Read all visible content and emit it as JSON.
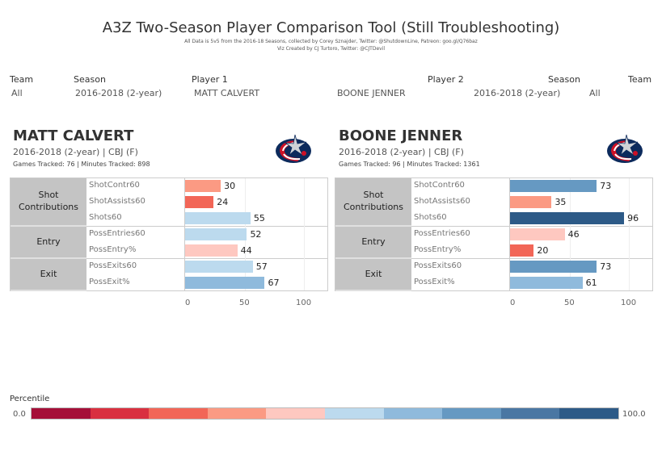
{
  "header": {
    "title": "A3Z Two-Season Player Comparison Tool (Still Troubleshooting)",
    "subtitle1": "All Data is 5v5 from the 2016-18 Seasons, collected by Corey Sznajder, Twitter: @ShutdownLine, Patreon: goo.gl/Q76baz",
    "subtitle2": "Viz Created by CJ Turtoro, Twitter: @CJTDevil"
  },
  "filters": {
    "team1": {
      "label": "Team",
      "value": "All"
    },
    "season1": {
      "label": "Season",
      "value": "2016-2018 (2-year)"
    },
    "player1": {
      "label": "Player 1",
      "value": "MATT CALVERT"
    },
    "player2": {
      "label": "Player 2",
      "value": "BOONE JENNER"
    },
    "season2": {
      "label": "Season",
      "value": "2016-2018 (2-year)"
    },
    "team2": {
      "label": "Team",
      "value": "All"
    }
  },
  "groups": [
    "Shot Contributions",
    "Entry",
    "Exit"
  ],
  "metrics": [
    "ShotContr60",
    "ShotAssists60",
    "Shots60",
    "PossEntries60",
    "PossEntry%",
    "PossExits60",
    "PossExit%"
  ],
  "axis_ticks": [
    "0",
    "50",
    "100"
  ],
  "players": [
    {
      "name": "MATT CALVERT",
      "info": "2016-2018 (2-year) | CBJ (F)",
      "games": "Games Tracked: 76  | Minutes Tracked: 898",
      "logo": "blue-jackets-logo",
      "values": [
        30,
        24,
        55,
        52,
        44,
        57,
        67
      ]
    },
    {
      "name": "BOONE JENNER",
      "info": "2016-2018 (2-year) | CBJ (F)",
      "games": "Games Tracked: 96  | Minutes Tracked: 1361",
      "logo": "blue-jackets-logo",
      "values": [
        73,
        35,
        96,
        46,
        20,
        73,
        61
      ]
    }
  ],
  "legend": {
    "title": "Percentile",
    "min": "0.0",
    "max": "100.0",
    "colors": [
      "#a50f38",
      "#d93040",
      "#f26657",
      "#fb9a83",
      "#fec8c0",
      "#bcdaee",
      "#8fbadc",
      "#6699c2",
      "#4a77a3",
      "#2d5a87"
    ]
  },
  "chart_data": [
    {
      "type": "bar",
      "title": "MATT CALVERT",
      "categories": [
        "ShotContr60",
        "ShotAssists60",
        "Shots60",
        "PossEntries60",
        "PossEntry%",
        "PossExits60",
        "PossExit%"
      ],
      "values": [
        30,
        24,
        55,
        52,
        44,
        57,
        67
      ],
      "xlim": [
        0,
        120
      ],
      "xticks": [
        0,
        50,
        100
      ],
      "orientation": "horizontal"
    },
    {
      "type": "bar",
      "title": "BOONE JENNER",
      "categories": [
        "ShotContr60",
        "ShotAssists60",
        "Shots60",
        "PossEntries60",
        "PossEntry%",
        "PossExits60",
        "PossExit%"
      ],
      "values": [
        73,
        35,
        96,
        46,
        20,
        73,
        61
      ],
      "xlim": [
        0,
        120
      ],
      "xticks": [
        0,
        50,
        100
      ],
      "orientation": "horizontal"
    }
  ]
}
